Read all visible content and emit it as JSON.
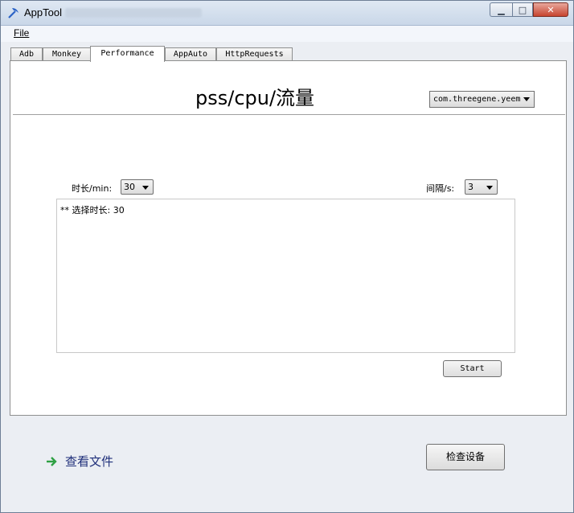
{
  "window": {
    "title": "AppTool"
  },
  "menu": {
    "file": "File"
  },
  "tabs": [
    {
      "label": "Adb"
    },
    {
      "label": "Monkey"
    },
    {
      "label": "Performance"
    },
    {
      "label": "AppAuto"
    },
    {
      "label": "HttpRequests"
    }
  ],
  "performance": {
    "heading": "pss/cpu/流量",
    "package_select": "com.threegene.yeem",
    "duration_label": "时长/min:",
    "duration_value": "30",
    "interval_label": "间隔/s:",
    "interval_value": "3",
    "log_text": "** 选择时长: 30",
    "start_label": "Start"
  },
  "bottom": {
    "view_files_label": "查看文件",
    "check_device_label": "检查设备"
  },
  "icons": {
    "app": "pickaxe-icon",
    "view_files": "green-arrow-icon",
    "minimize": "minimize-icon",
    "maximize": "maximize-icon",
    "close": "close-icon",
    "dropdown": "chevron-down-icon"
  },
  "colors": {
    "close_button": "#c7442f",
    "link_text": "#1f2f7a",
    "arrow": "#2ea043"
  }
}
